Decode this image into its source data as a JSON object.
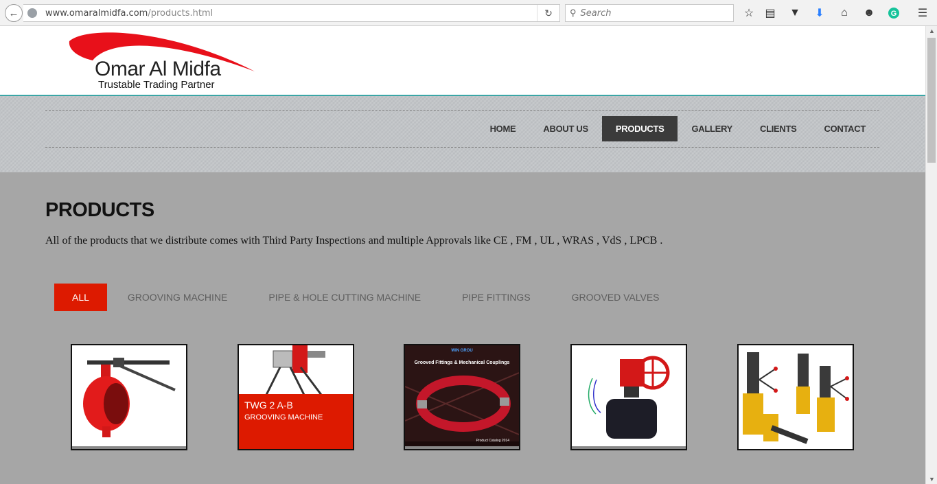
{
  "browser": {
    "url_host": "www.omaralmidfa.com",
    "url_path": "/products.html",
    "search_placeholder": "Search"
  },
  "logo": {
    "name": "Omar Al Midfa",
    "tagline": "Trustable Trading Partner",
    "accent_color": "#e8101a"
  },
  "nav": {
    "items": [
      {
        "label": "HOME",
        "active": false
      },
      {
        "label": "ABOUT US",
        "active": false
      },
      {
        "label": "PRODUCTS",
        "active": true
      },
      {
        "label": "GALLERY",
        "active": false
      },
      {
        "label": "CLIENTS",
        "active": false
      },
      {
        "label": "CONTACT",
        "active": false
      }
    ]
  },
  "main": {
    "title": "PRODUCTS",
    "description": "All of the products that we distribute comes with Third Party Inspections and multiple Approvals like CE , FM , UL , WRAS , VdS , LPCB ."
  },
  "filters": [
    {
      "label": "ALL",
      "active": true
    },
    {
      "label": "GROOVING MACHINE",
      "active": false
    },
    {
      "label": "PIPE & HOLE CUTTING MACHINE",
      "active": false
    },
    {
      "label": "PIPE FITTINGS",
      "active": false
    },
    {
      "label": "GROOVED VALVES",
      "active": false
    }
  ],
  "products": [
    {
      "image": "butterfly-valve-lever-image"
    },
    {
      "image": "grooving-machine-image",
      "title": "TWG 2 A-B",
      "subtitle": "GROOVING MACHINE"
    },
    {
      "image": "catalog-cover-image",
      "brand": "WIN GROU",
      "heading": "Grooved Fittings & Mechanical Couplings",
      "footer": "Product Catalog 2014"
    },
    {
      "image": "butterfly-valve-gear-image"
    },
    {
      "image": "core-drilling-machines-image"
    }
  ],
  "colors": {
    "accent_red": "#dd1a00",
    "nav_active": "#3b3b3b",
    "header_rule": "#3aa6a6",
    "page_bg": "#a6a6a6"
  }
}
